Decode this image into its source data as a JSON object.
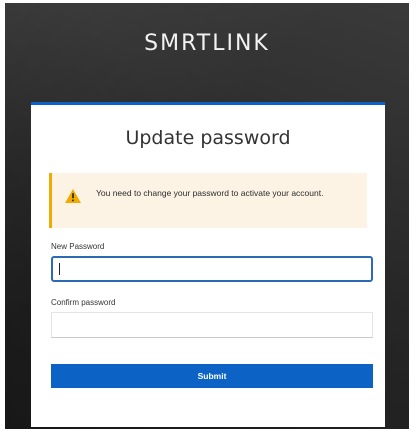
{
  "brand": {
    "name": "SMRTLINK"
  },
  "form": {
    "title": "Update password",
    "alert": {
      "icon": "warning-triangle-icon",
      "message": "You need to change your password to activate your account."
    },
    "new_password": {
      "label": "New Password",
      "value": "",
      "placeholder": ""
    },
    "confirm_password": {
      "label": "Confirm password",
      "value": "",
      "placeholder": ""
    },
    "submit_label": "Submit"
  },
  "colors": {
    "accent": "#0d63c5",
    "warning": "#f0ab00",
    "alert_background": "#fdf3e5",
    "page_background": "#2b2b2b"
  }
}
